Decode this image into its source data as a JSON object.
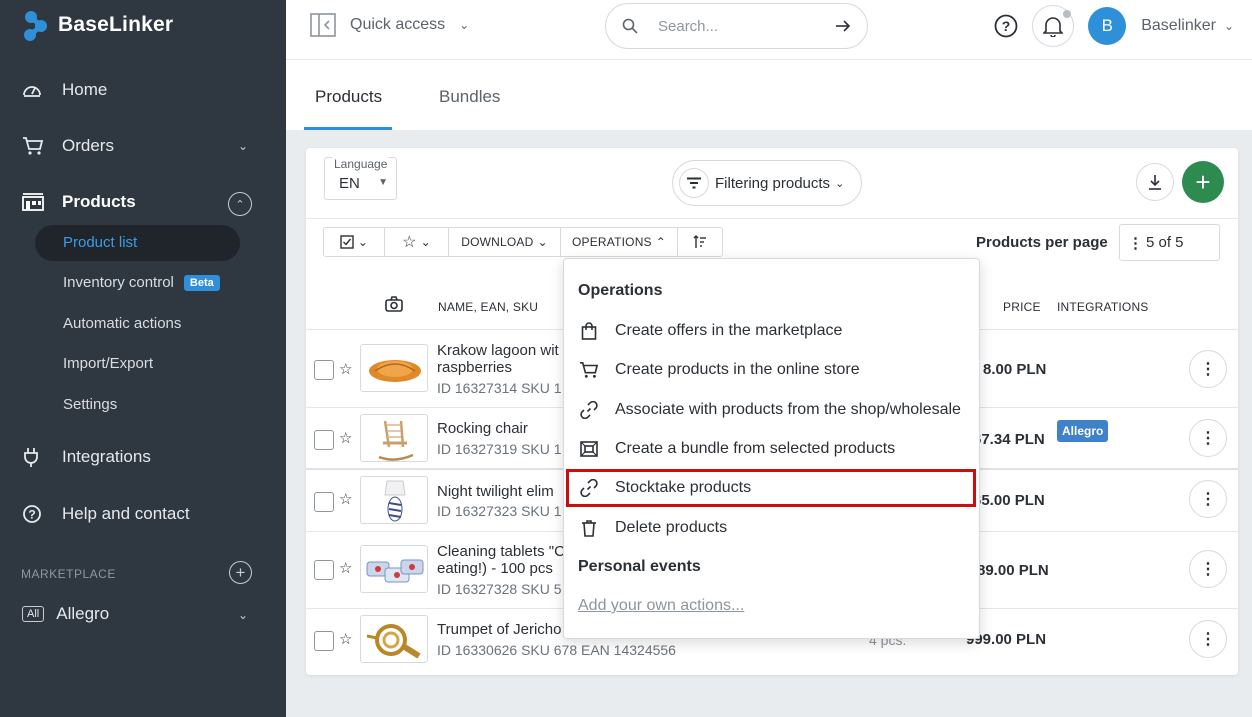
{
  "app": {
    "brand": "BaseLinker"
  },
  "sidebar": {
    "nav": [
      {
        "label": "Home",
        "icon": "dashboard-icon"
      },
      {
        "label": "Orders",
        "icon": "cart-icon"
      },
      {
        "label": "Products",
        "icon": "products-icon"
      },
      {
        "label": "Integrations",
        "icon": "plug-icon"
      },
      {
        "label": "Help and contact",
        "icon": "help-icon"
      }
    ],
    "products_sub": [
      {
        "label": "Product list"
      },
      {
        "label": "Inventory control",
        "badge": "Beta"
      },
      {
        "label": "Automatic actions"
      },
      {
        "label": "Import/Export"
      },
      {
        "label": "Settings"
      }
    ],
    "marketplace_label": "MARKETPLACE",
    "marketplace_item": {
      "badge": "All",
      "label": "Allegro"
    }
  },
  "topbar": {
    "quick_access": "Quick access",
    "search_placeholder": "Search...",
    "user_initial": "B",
    "user_name": "Baselinker"
  },
  "tabs": [
    {
      "label": "Products",
      "active": true
    },
    {
      "label": "Bundles",
      "active": false
    }
  ],
  "filters": {
    "language_label": "Language",
    "language_value": "EN",
    "filter_button": "Filtering products"
  },
  "toolbar": {
    "download": "DOWNLOAD",
    "operations": "OPERATIONS",
    "per_page_label": "Products per page",
    "per_page_value": "5 of 5"
  },
  "table": {
    "headers": {
      "name": "NAME, EAN, SKU",
      "price": "PRICE",
      "integrations": "INTEGRATIONS"
    },
    "rows": [
      {
        "name": "Krakow lagoon wit raspberries",
        "id": "ID 16327314 SKU 1",
        "price": "8.00 PLN",
        "qty": "",
        "badge": ""
      },
      {
        "name": "Rocking chair",
        "id": "ID 16327319 SKU 1",
        "price": "67.34 PLN",
        "qty": "",
        "badge": "Allegro"
      },
      {
        "name": "Night twilight elim",
        "id": "ID 16327323 SKU 1",
        "price": "65.00 PLN",
        "qty": "",
        "badge": ""
      },
      {
        "name": "Cleaning tablets \"C eating!) - 100 pcs",
        "id": "ID 16327328 SKU 5",
        "price": "89.00 PLN",
        "qty": "",
        "badge": ""
      },
      {
        "name": "Trumpet of Jericho",
        "id": "ID 16330626 SKU 678 EAN 14324556",
        "price": "999.00 PLN",
        "qty": "4 pcs.",
        "badge": ""
      }
    ]
  },
  "operations_menu": {
    "heading": "Operations",
    "items": [
      {
        "label": "Create offers in the marketplace",
        "icon": "shopping-bag-icon"
      },
      {
        "label": "Create products in the online store",
        "icon": "cart-icon"
      },
      {
        "label": "Associate with products from the shop/wholesale",
        "icon": "link-icon"
      },
      {
        "label": "Create a bundle from selected products",
        "icon": "bundle-icon"
      },
      {
        "label": "Stocktake products",
        "icon": "link-icon"
      },
      {
        "label": "Delete products",
        "icon": "trash-icon"
      }
    ],
    "personal_heading": "Personal events",
    "add_actions": "Add your own actions..."
  },
  "colors": {
    "sidebar_bg": "#2f3740",
    "accent": "#2f8fd8",
    "add_button": "#2e8b4f",
    "highlight": "#cc0d0d"
  }
}
